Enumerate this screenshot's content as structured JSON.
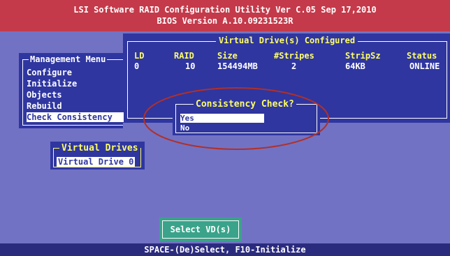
{
  "titlebar": {
    "line1": "LSI Software RAID Configuration Utility Ver C.05 Sep 17,2010",
    "line2": "BIOS Version  A.10.09231523R"
  },
  "virtual_drives_configured": {
    "title": "Virtual Drive(s) Configured",
    "columns": [
      "LD",
      "RAID",
      "Size",
      "#Stripes",
      "StripSz",
      "Status"
    ],
    "rows": [
      [
        "0",
        "10",
        "154494MB",
        "2",
        "64KB",
        "ONLINE"
      ]
    ]
  },
  "management_menu": {
    "title": "Management Menu",
    "items": [
      "Configure",
      "Initialize",
      "Objects",
      "Rebuild",
      "Check Consistency"
    ],
    "selected": "Check Consistency"
  },
  "consistency_dialog": {
    "title": "Consistency Check?",
    "options": [
      "Yes",
      "No"
    ],
    "selected": "Yes"
  },
  "virtual_drives": {
    "title": "Virtual Drives",
    "items": [
      "Virtual Drive 0"
    ]
  },
  "select_button": {
    "label": "Select VD(s)"
  },
  "statusbar": {
    "text": "SPACE-(De)Select, F10-Initialize"
  },
  "colors": {
    "background": "#7272c4",
    "panel": "#2f36a0",
    "titlebar": "#c43a4a",
    "highlight_text": "#ffff66",
    "button": "#3aa38a",
    "annotation_oval": "#b03028"
  }
}
